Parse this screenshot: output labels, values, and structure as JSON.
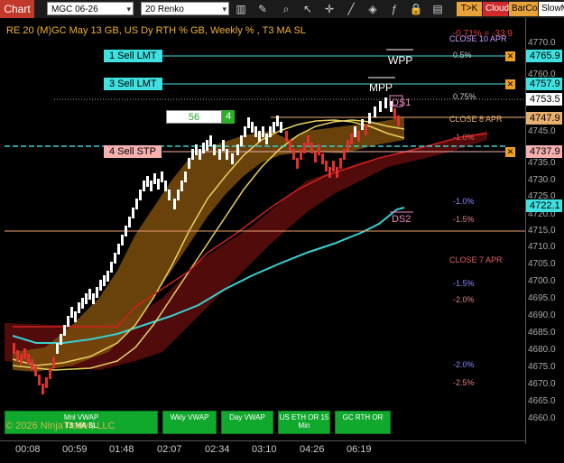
{
  "toolbar": {
    "title": "Chart",
    "instrument": "MGC 06-26",
    "bar_type": "20 Renko",
    "buttons": [
      {
        "label": "T>K",
        "color": "#e8a23a"
      },
      {
        "label": "Cloud",
        "color": "#d02a2a"
      },
      {
        "label": "BarCol",
        "color": "#e8a23a"
      },
      {
        "label": "SlowM",
        "color": "#ffffff"
      }
    ]
  },
  "chart": {
    "title": "RE 20  (M)GC May 13 GB, US Dy RTH % GB, Weekly % , T3 MA SL",
    "performance": "-0.71% = -33.9",
    "colors": {
      "bull": "#ffffff",
      "bear": "#e03030",
      "cloud_dark": "#6a1010",
      "cloud_orange": "#8a5a10",
      "vwap_cyan": "#3ad0d0",
      "ma_yellow": "#e8d060"
    }
  },
  "orders": [
    {
      "label": "1 Sell LMT",
      "price": "4765.9"
    },
    {
      "label": "3 Sell LMT",
      "price": "4757.9"
    },
    {
      "label": "4 Sell STP",
      "price": "4737.9"
    }
  ],
  "order_entry": {
    "price": "56",
    "qty": "4"
  },
  "annotations": {
    "wpp": "WPP",
    "mpp": "MPP",
    "ds1": "DS1",
    "ds2": "DS2",
    "close_10apr": "CLOSE 10 APR",
    "close_8apr": "CLOSE 8 APR",
    "close_7apr": "CLOSE 7 APR"
  },
  "percent_labels": [
    "0.5%",
    "0.75%",
    "0.5%",
    "-1.0%",
    "-1.0%",
    "-1.5%",
    "-1.5%",
    "-2.0%",
    "-2.0%",
    "-2.5%"
  ],
  "price_labels": [
    {
      "price": "4765.9",
      "color": "#40e0e0"
    },
    {
      "price": "4757.9",
      "color": "#40e0e0"
    },
    {
      "price": "4753.5",
      "color": "#ffffff"
    },
    {
      "price": "4747.9",
      "color": "#e8b070"
    },
    {
      "price": "4737.9",
      "color": "#f6b0b0"
    },
    {
      "price": "4722.1",
      "color": "#40e0e0"
    }
  ],
  "price_axis": [
    "4770.0",
    "4760.0",
    "4755.0",
    "4745.0",
    "4740.0",
    "4735.0",
    "4730.0",
    "4725.0",
    "4720.0",
    "4715.0",
    "4710.0",
    "4705.0",
    "4700.0",
    "4695.0",
    "4690.0",
    "4685.0",
    "4680.0",
    "4675.0",
    "4670.0",
    "4665.0",
    "4660.0"
  ],
  "time_axis": [
    "00:08",
    "00:59",
    "01:48",
    "02:07",
    "02:34",
    "03:10",
    "04:26",
    "06:19"
  ],
  "bottom_buttons": [
    {
      "label": "Mnl VWAP",
      "sub": "T3 MA SL"
    },
    {
      "label": "Wkly VWAP",
      "sub": ""
    },
    {
      "label": "Day VWAP",
      "sub": ""
    },
    {
      "label": "US ETH OR 15 Min",
      "sub": ""
    },
    {
      "label": "GC RTH OR",
      "sub": ""
    }
  ],
  "watermark": "© 2026 NinjaTrader, LLC"
}
